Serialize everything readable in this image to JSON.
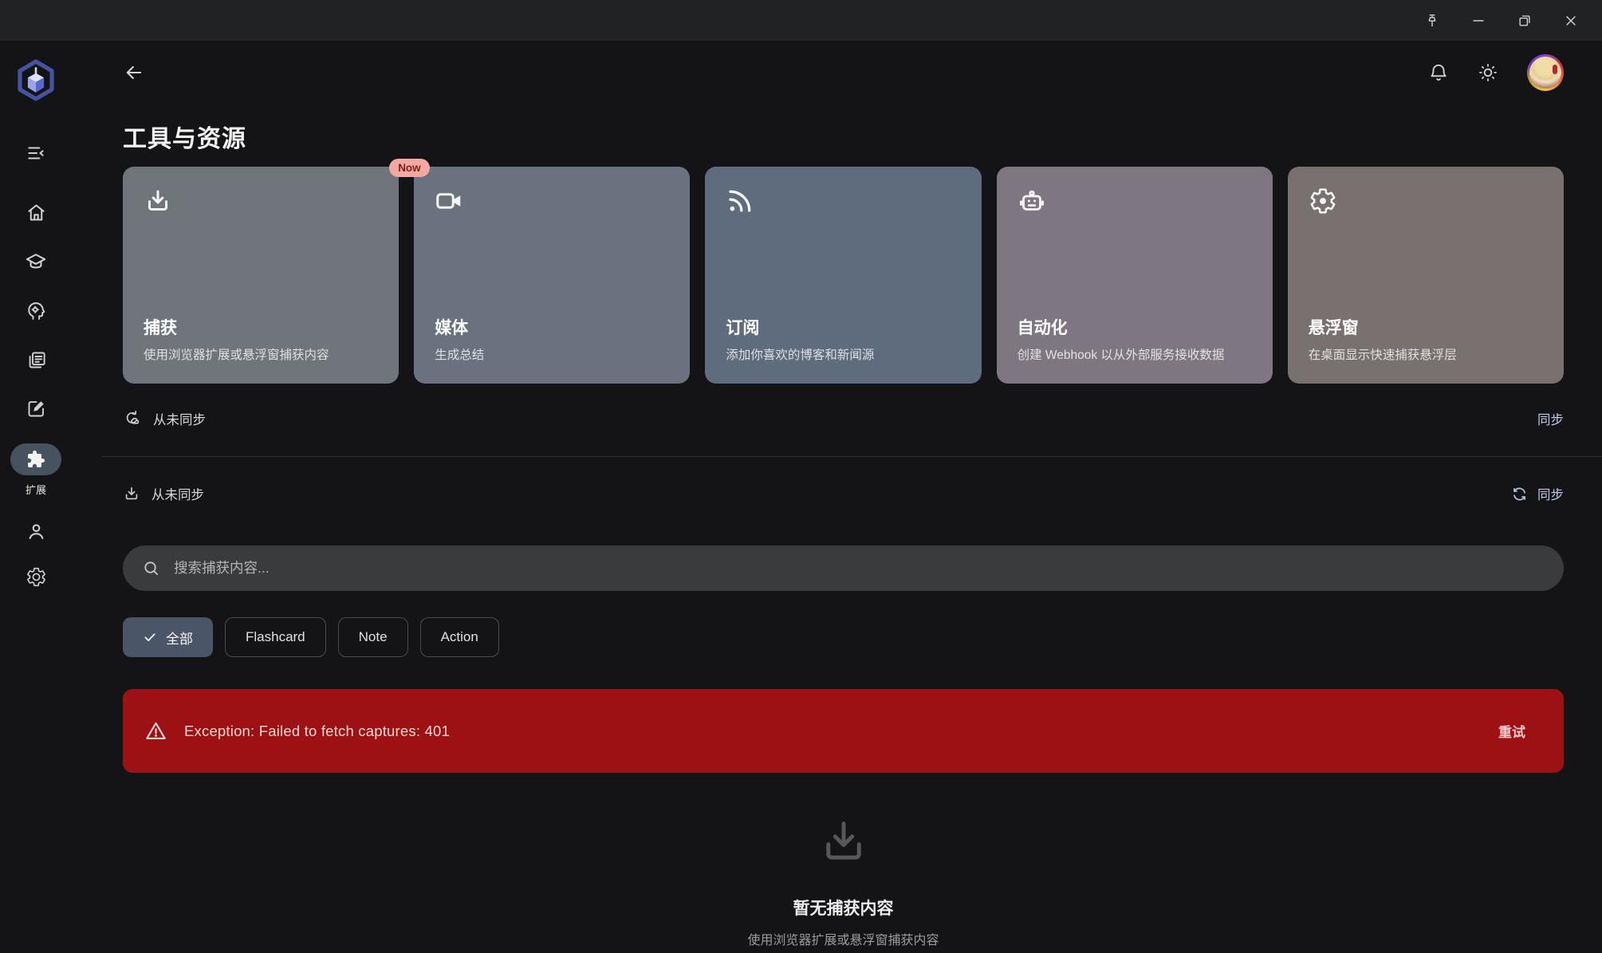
{
  "page": {
    "title": "工具与资源"
  },
  "sidebar": {
    "active_item": {
      "label": "扩展"
    }
  },
  "cards": [
    {
      "title": "捕获",
      "subtitle": "使用浏览器扩展或悬浮窗捕获内容",
      "icon": "download-icon",
      "bg": "#6f757b"
    },
    {
      "title": "媒体",
      "subtitle": "生成总结",
      "icon": "video-camera-icon",
      "bg": "#69727e",
      "badge": "Now"
    },
    {
      "title": "订阅",
      "subtitle": "添加你喜欢的博客和新闻源",
      "icon": "rss-icon",
      "bg": "#5f6c7e"
    },
    {
      "title": "自动化",
      "subtitle": "创建 Webhook 以从外部服务接收数据",
      "icon": "robot-icon",
      "bg": "#7e7680"
    },
    {
      "title": "悬浮窗",
      "subtitle": "在桌面显示快速捕获悬浮层",
      "icon": "gear-icon",
      "bg": "#797170"
    }
  ],
  "sync": {
    "row1": {
      "status": "从未同步",
      "action": "同步"
    },
    "row2": {
      "status": "从未同步",
      "action": "同步"
    }
  },
  "search": {
    "placeholder": "搜索捕获内容..."
  },
  "filters": {
    "all": "全部",
    "flashcard": "Flashcard",
    "note": "Note",
    "action": "Action"
  },
  "error_banner": {
    "message": "Exception: Failed to fetch captures: 401",
    "retry_label": "重试"
  },
  "empty_state": {
    "title": "暂无捕获内容",
    "subtitle": "使用浏览器扩展或悬浮窗捕获内容"
  },
  "colors": {
    "error_bg": "#9d1014",
    "badge_bg": "#f2a9a4",
    "badge_text": "#7c1d18",
    "sync_link": "#b9c9e8",
    "chip_active_bg": "#4a5668"
  }
}
